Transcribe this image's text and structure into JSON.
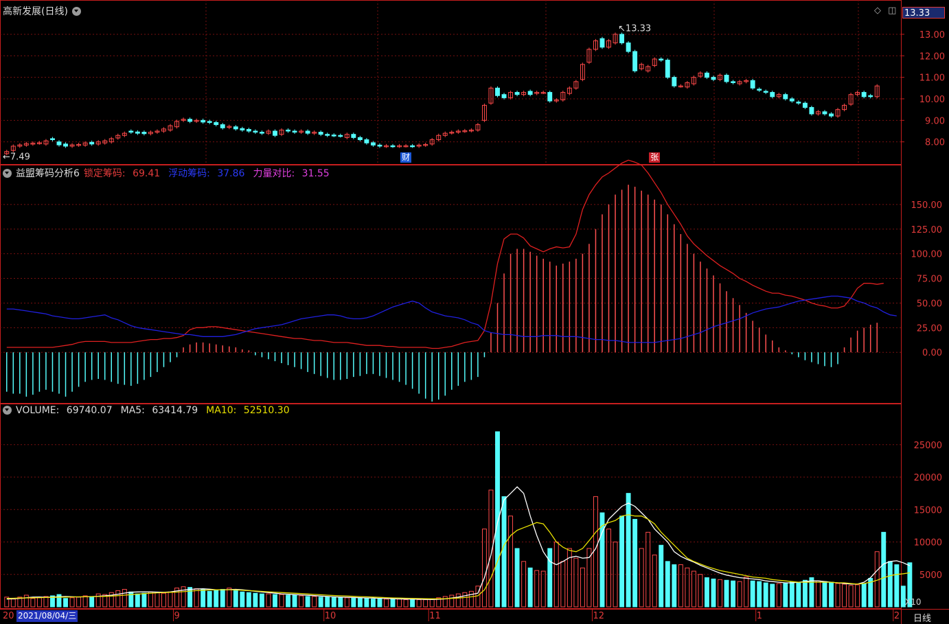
{
  "header": {
    "stock_name": "高新发展(日线)",
    "indicator_name": "益盟筹码分析6",
    "locked": {
      "label": "锁定筹码:",
      "value": "69.41",
      "color": "#e23b3b"
    },
    "floating": {
      "label": "浮动筹码:",
      "value": "37.86",
      "color": "#2a3af5"
    },
    "force": {
      "label": "力量对比:",
      "value": "31.55",
      "color": "#e040e0"
    },
    "volume_label": "VOLUME:",
    "volume_value": "69740.07",
    "ma5_label": "MA5:",
    "ma5_value": "63414.79",
    "ma10_label": "MA10:",
    "ma10_value": "52510.30",
    "current_price": "13.33",
    "max_label": "13.33",
    "min_label": "7.49",
    "x10": "X10",
    "period_tab": "日线",
    "date_box": "2021/08/04/三",
    "year_prefix": "20"
  },
  "events": [
    {
      "text": "财",
      "color": "#1b57d6"
    },
    {
      "text": "张",
      "color": "#c8202a"
    }
  ],
  "x_labels": [
    {
      "text": "9",
      "i": 26
    },
    {
      "text": "10",
      "i": 49
    },
    {
      "text": "11",
      "i": 65
    },
    {
      "text": "12",
      "i": 90
    },
    {
      "text": "1",
      "i": 115
    },
    {
      "text": "2",
      "i": 136
    }
  ],
  "colors": {
    "up": "#ff4a4a",
    "down": "#54fcfc",
    "grid": "#7a1010",
    "frame": "#c81e1e",
    "axis_text": "#e23b3b",
    "ma_white": "#ffffff",
    "ma_yellow": "#e8e000",
    "locked_line": "#e02020",
    "floating_line": "#2020e0"
  },
  "chart_data": [
    {
      "type": "candlestick",
      "y_ticks": [
        8.0,
        9.0,
        10.0,
        11.0,
        12.0,
        13.0
      ],
      "ylim": [
        7.0,
        13.7
      ],
      "closes": [
        7.55,
        7.8,
        7.86,
        7.92,
        7.94,
        7.96,
        8.05,
        8.1,
        7.86,
        7.8,
        7.86,
        7.88,
        7.95,
        7.9,
        8.0,
        8.05,
        8.15,
        8.3,
        8.4,
        8.45,
        8.4,
        8.38,
        8.45,
        8.5,
        8.6,
        8.75,
        8.95,
        9.05,
        8.95,
        9.0,
        8.92,
        8.9,
        8.8,
        8.65,
        8.72,
        8.6,
        8.55,
        8.5,
        8.45,
        8.4,
        8.5,
        8.3,
        8.55,
        8.5,
        8.45,
        8.5,
        8.4,
        8.45,
        8.35,
        8.3,
        8.3,
        8.28,
        8.35,
        8.2,
        8.1,
        7.95,
        7.85,
        7.8,
        7.82,
        7.8,
        7.82,
        7.82,
        7.8,
        7.85,
        7.88,
        8.1,
        8.3,
        8.4,
        8.45,
        8.5,
        8.52,
        8.55,
        8.8,
        9.7,
        10.5,
        10.15,
        10.05,
        10.3,
        10.2,
        10.3,
        10.2,
        10.3,
        10.3,
        9.9,
        9.95,
        10.3,
        10.5,
        10.8,
        11.6,
        12.3,
        12.7,
        12.4,
        12.7,
        13.0,
        12.6,
        12.2,
        11.3,
        11.6,
        11.5,
        11.85,
        11.8,
        11.0,
        10.6,
        10.6,
        10.75,
        11.0,
        11.2,
        11.0,
        10.9,
        11.1,
        10.8,
        10.75,
        10.8,
        10.85,
        10.5,
        10.4,
        10.3,
        10.1,
        10.2,
        10.0,
        9.9,
        9.8,
        9.6,
        9.3,
        9.4,
        9.3,
        9.2,
        9.5,
        9.7,
        10.2,
        10.3,
        10.1,
        10.1,
        10.6
      ],
      "opens": [
        7.45,
        7.6,
        7.8,
        7.85,
        7.9,
        7.95,
        7.9,
        8.15,
        8.0,
        7.9,
        7.8,
        7.85,
        7.85,
        7.98,
        7.9,
        7.95,
        8.0,
        8.18,
        8.3,
        8.5,
        8.46,
        8.45,
        8.38,
        8.45,
        8.5,
        8.55,
        8.7,
        9.0,
        9.05,
        8.96,
        9.0,
        8.95,
        8.9,
        8.8,
        8.67,
        8.7,
        8.62,
        8.58,
        8.5,
        8.45,
        8.4,
        8.5,
        8.35,
        8.55,
        8.5,
        8.45,
        8.5,
        8.4,
        8.45,
        8.35,
        8.32,
        8.3,
        8.2,
        8.35,
        8.2,
        8.1,
        7.96,
        7.85,
        7.8,
        7.82,
        7.8,
        7.82,
        7.82,
        7.8,
        7.85,
        7.9,
        8.1,
        8.3,
        8.42,
        8.45,
        8.5,
        8.52,
        8.55,
        9.0,
        9.8,
        10.5,
        10.2,
        10.05,
        10.3,
        10.2,
        10.35,
        10.25,
        10.3,
        10.3,
        9.9,
        9.95,
        10.25,
        10.5,
        10.9,
        11.7,
        12.3,
        12.8,
        12.4,
        12.6,
        13.0,
        12.6,
        12.2,
        11.4,
        11.3,
        11.55,
        11.85,
        11.8,
        11.0,
        10.6,
        10.55,
        10.7,
        11.05,
        11.2,
        11.0,
        10.9,
        11.1,
        10.8,
        10.7,
        10.8,
        10.85,
        10.45,
        10.35,
        10.3,
        10.1,
        10.2,
        10.0,
        9.85,
        9.8,
        9.6,
        9.3,
        9.4,
        9.3,
        9.2,
        9.5,
        9.75,
        10.2,
        10.3,
        10.15,
        10.1
      ],
      "high": 13.33,
      "low": 7.49
    },
    {
      "type": "bar+line",
      "y_ticks": [
        0,
        25,
        50,
        75,
        100,
        125,
        150
      ],
      "ylim": [
        -50,
        175
      ],
      "bars": [
        -40,
        -42,
        -42,
        -45,
        -43,
        -40,
        -38,
        -40,
        -42,
        -45,
        -40,
        -35,
        -30,
        -28,
        -27,
        -28,
        -30,
        -32,
        -33,
        -34,
        -32,
        -28,
        -25,
        -20,
        -15,
        -10,
        -5,
        5,
        8,
        10,
        10,
        9,
        8,
        7,
        6,
        5,
        3,
        2,
        -3,
        -5,
        -7,
        -9,
        -11,
        -13,
        -15,
        -17,
        -20,
        -22,
        -24,
        -26,
        -28,
        -28,
        -27,
        -25,
        -24,
        -22,
        -22,
        -24,
        -26,
        -28,
        -30,
        -33,
        -37,
        -42,
        -47,
        -50,
        -48,
        -44,
        -38,
        -34,
        -30,
        -28,
        -25,
        -5,
        20,
        50,
        80,
        100,
        105,
        105,
        102,
        98,
        95,
        92,
        88,
        90,
        92,
        95,
        100,
        110,
        125,
        140,
        150,
        160,
        165,
        170,
        168,
        164,
        160,
        155,
        150,
        140,
        130,
        120,
        110,
        100,
        92,
        85,
        78,
        70,
        62,
        55,
        48,
        40,
        32,
        25,
        18,
        12,
        5,
        2,
        -2,
        -5,
        -8,
        -10,
        -12,
        -14,
        -15,
        -12,
        5,
        15,
        22,
        25,
        28,
        30
      ],
      "locked": [
        5,
        5,
        5,
        5,
        5,
        5,
        5,
        5,
        6,
        7,
        8,
        10,
        11,
        11,
        11,
        11,
        10,
        10,
        10,
        10,
        11,
        12,
        13,
        13,
        14,
        14,
        15,
        17,
        23,
        25,
        25,
        26,
        26,
        25,
        24,
        23,
        22,
        21,
        20,
        19,
        18,
        17,
        16,
        15,
        14,
        14,
        13,
        12,
        12,
        11,
        10,
        10,
        10,
        9,
        8,
        7,
        7,
        7,
        6,
        6,
        5,
        5,
        5,
        5,
        5,
        4,
        4,
        5,
        6,
        8,
        10,
        11,
        12,
        22,
        50,
        90,
        115,
        120,
        120,
        116,
        108,
        105,
        102,
        105,
        107,
        106,
        107,
        120,
        145,
        160,
        170,
        178,
        182,
        187,
        192,
        195,
        193,
        190,
        182,
        172,
        162,
        150,
        140,
        130,
        118,
        110,
        104,
        98,
        93,
        88,
        84,
        80,
        75,
        72,
        68,
        65,
        62,
        60,
        60,
        58,
        57,
        55,
        53,
        50,
        48,
        47,
        45,
        45,
        47,
        55,
        65,
        70,
        70,
        69,
        70
      ],
      "floating": [
        44,
        44,
        43,
        42,
        41,
        40,
        39,
        37,
        36,
        35,
        34,
        34,
        35,
        36,
        37,
        38,
        35,
        33,
        30,
        27,
        25,
        24,
        23,
        22,
        21,
        20,
        19,
        18,
        18,
        17,
        16,
        16,
        16,
        16,
        17,
        18,
        20,
        22,
        24,
        25,
        26,
        27,
        28,
        30,
        32,
        34,
        35,
        36,
        37,
        38,
        38,
        37,
        35,
        34,
        34,
        35,
        37,
        40,
        43,
        46,
        48,
        50,
        52,
        50,
        45,
        41,
        39,
        37,
        36,
        35,
        33,
        30,
        28,
        22,
        20,
        19,
        18,
        18,
        17,
        16,
        16,
        16,
        17,
        17,
        17,
        16,
        16,
        16,
        15,
        14,
        13,
        13,
        12,
        12,
        11,
        10,
        10,
        10,
        10,
        10,
        11,
        12,
        13,
        14,
        16,
        18,
        20,
        23,
        26,
        28,
        30,
        32,
        34,
        37,
        40,
        42,
        44,
        45,
        46,
        48,
        50,
        52,
        53,
        54,
        55,
        56,
        57,
        57,
        56,
        55,
        52,
        50,
        47,
        45,
        41,
        38,
        37
      ],
      "force_value": 31.55
    },
    {
      "type": "bar+line",
      "y_ticks": [
        5000,
        10000,
        15000,
        20000,
        25000
      ],
      "ylim": [
        0,
        29000
      ],
      "volumes": [
        1500,
        1200,
        1500,
        1800,
        1300,
        1400,
        1600,
        1700,
        1900,
        1300,
        1400,
        1500,
        1700,
        1600,
        2000,
        1900,
        2200,
        2500,
        2700,
        2300,
        2000,
        2100,
        2300,
        2200,
        2100,
        2300,
        2900,
        3100,
        3000,
        2800,
        2700,
        2400,
        2600,
        2700,
        2900,
        2500,
        2300,
        2200,
        2100,
        2000,
        2000,
        1900,
        1900,
        1800,
        1800,
        1700,
        1600,
        1600,
        1500,
        1500,
        1500,
        1400,
        1400,
        1400,
        1300,
        1300,
        1200,
        1200,
        1200,
        1200,
        1200,
        1100,
        1100,
        1100,
        1100,
        1200,
        1400,
        1600,
        1800,
        2000,
        2200,
        2400,
        3200,
        12000,
        18000,
        27000,
        17000,
        14000,
        9000,
        7000,
        6000,
        5600,
        5500,
        9000,
        10000,
        7000,
        9000,
        7500,
        6000,
        9000,
        17000,
        14500,
        12000,
        10000,
        14000,
        17500,
        13500,
        9000,
        11500,
        8000,
        9500,
        7000,
        6500,
        6500,
        6000,
        5500,
        5000,
        4500,
        4300,
        4200,
        4100,
        4000,
        3900,
        4600,
        4000,
        3900,
        3700,
        3500,
        3600,
        3600,
        3800,
        3800,
        4100,
        4500,
        4000,
        3900,
        3800,
        3600,
        3500,
        3300,
        3400,
        3600,
        4400,
        8500,
        11500,
        7000,
        6500,
        3200,
        6800
      ],
      "ma5": [
        1200,
        1250,
        1300,
        1400,
        1500,
        1520,
        1480,
        1500,
        1560,
        1600,
        1560,
        1520,
        1550,
        1580,
        1640,
        1700,
        1800,
        1950,
        2120,
        2250,
        2300,
        2320,
        2300,
        2280,
        2240,
        2300,
        2460,
        2580,
        2680,
        2750,
        2780,
        2720,
        2640,
        2620,
        2660,
        2700,
        2640,
        2520,
        2400,
        2300,
        2200,
        2100,
        2000,
        1950,
        1880,
        1840,
        1780,
        1730,
        1660,
        1600,
        1550,
        1500,
        1470,
        1440,
        1410,
        1380,
        1350,
        1310,
        1280,
        1250,
        1220,
        1200,
        1180,
        1160,
        1140,
        1130,
        1160,
        1220,
        1350,
        1500,
        1700,
        1900,
        2100,
        4500,
        8000,
        13000,
        16500,
        17500,
        18500,
        17500,
        14000,
        11000,
        8500,
        7000,
        6500,
        7000,
        7600,
        7800,
        7500,
        7600,
        9000,
        11500,
        13500,
        14500,
        15500,
        16000,
        15500,
        14500,
        13500,
        12000,
        11000,
        10000,
        8500,
        7800,
        7300,
        6900,
        6400,
        6000,
        5600,
        5200,
        4900,
        4700,
        4500,
        4400,
        4300,
        4200,
        4000,
        3900,
        3800,
        3700,
        3700,
        3800,
        3900,
        4000,
        4000,
        3900,
        3800,
        3700,
        3600,
        3500,
        3500,
        3800,
        4500,
        5600,
        6600,
        7000,
        7100,
        6800,
        6341
      ],
      "ma10": [
        1300,
        1320,
        1350,
        1380,
        1400,
        1420,
        1440,
        1460,
        1480,
        1500,
        1520,
        1540,
        1560,
        1580,
        1600,
        1620,
        1660,
        1720,
        1800,
        1880,
        1960,
        2040,
        2100,
        2160,
        2200,
        2240,
        2280,
        2340,
        2420,
        2500,
        2560,
        2600,
        2620,
        2640,
        2640,
        2600,
        2560,
        2500,
        2440,
        2380,
        2320,
        2260,
        2200,
        2150,
        2100,
        2040,
        1980,
        1920,
        1860,
        1800,
        1750,
        1700,
        1660,
        1620,
        1580,
        1540,
        1500,
        1460,
        1420,
        1380,
        1350,
        1320,
        1300,
        1280,
        1260,
        1240,
        1240,
        1260,
        1300,
        1360,
        1440,
        1540,
        1700,
        2600,
        4500,
        7000,
        9500,
        11000,
        11800,
        12200,
        12600,
        13000,
        12800,
        11500,
        10000,
        9200,
        8700,
        8500,
        9000,
        10200,
        11500,
        12500,
        13000,
        13300,
        14000,
        14200,
        14000,
        14000,
        13500,
        12800,
        11500,
        10500,
        9500,
        8500,
        7500,
        7000,
        6600,
        6200,
        5900,
        5600,
        5400,
        5200,
        5000,
        4800,
        4600,
        4500,
        4400,
        4200,
        4100,
        4000,
        3900,
        3800,
        3800,
        3800,
        3800,
        3800,
        3800,
        3700,
        3700,
        3600,
        3500,
        3600,
        3800,
        4100,
        4500,
        4800,
        5000,
        5100,
        5251
      ]
    }
  ]
}
